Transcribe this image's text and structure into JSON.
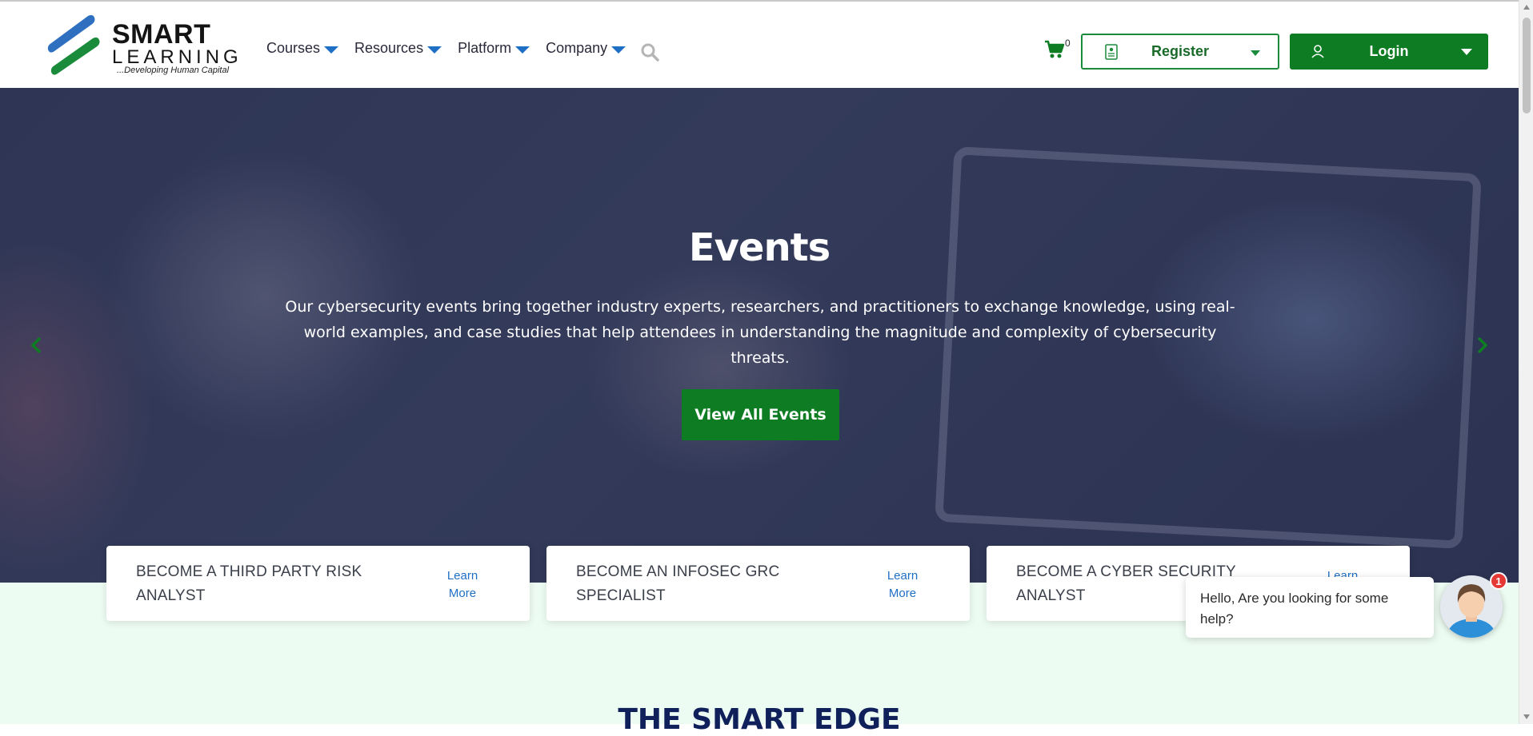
{
  "logo": {
    "line1": "SMART",
    "line2": "LEARNING",
    "tagline": "...Developing Human Capital",
    "colors": {
      "blue": "#2f6fc0",
      "green": "#1a8b3a"
    }
  },
  "nav": {
    "items": [
      {
        "label": "Courses"
      },
      {
        "label": "Resources"
      },
      {
        "label": "Platform"
      },
      {
        "label": "Company"
      }
    ],
    "search_icon": "search-icon"
  },
  "cart": {
    "count": "0",
    "icon": "cart-icon"
  },
  "register": {
    "label": "Register",
    "icon": "document-icon"
  },
  "login": {
    "label": "Login",
    "icon": "user-icon"
  },
  "hero": {
    "title": "Events",
    "description": "Our cybersecurity events bring together industry experts, researchers, and practitioners to exchange knowledge, using real-world examples, and case studies that help attendees in understanding the magnitude and complexity of cybersecurity threats.",
    "button": "View All Events"
  },
  "cards": [
    {
      "title": "BECOME A THIRD PARTY RISK ANALYST",
      "link": "Learn More"
    },
    {
      "title": "BECOME AN INFOSEC GRC SPECIALIST",
      "link": "Learn More"
    },
    {
      "title": "BECOME A CYBER SECURITY ANALYST",
      "link": "Learn More"
    }
  ],
  "section": {
    "title": "THE SMART EDGE"
  },
  "chat": {
    "message": "Hello, Are you looking for some help?",
    "badge": "1"
  },
  "colors": {
    "primary_green": "#0e7c23",
    "link_blue": "#1f6fc5",
    "heading_navy": "#10205a",
    "section_bg": "#edfcf3"
  }
}
